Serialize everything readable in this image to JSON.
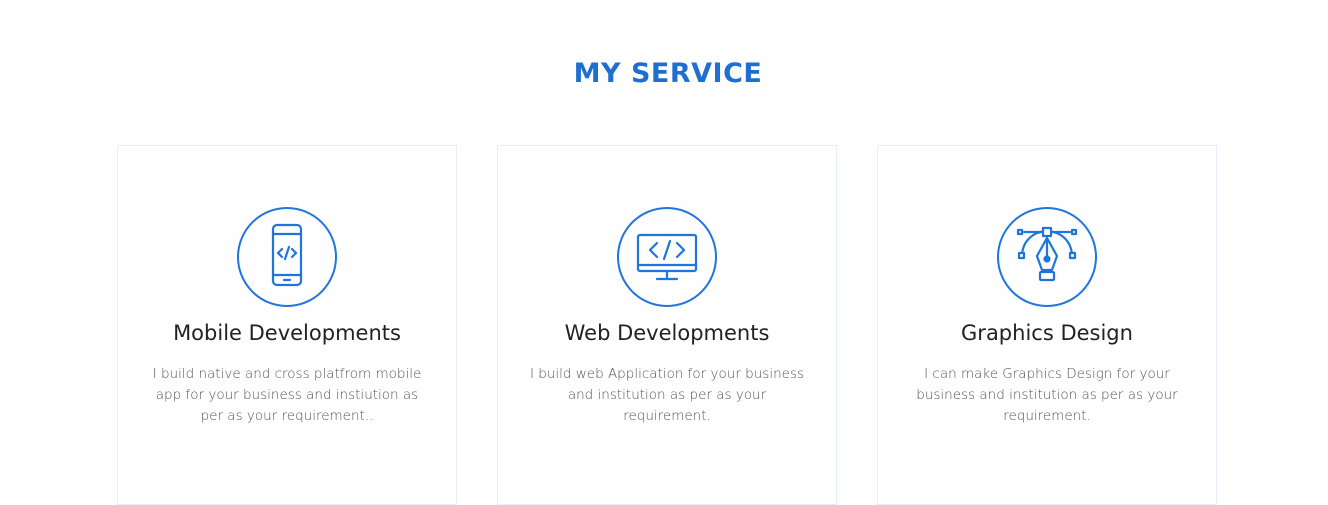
{
  "section": {
    "title": "MY SERVICE"
  },
  "services": [
    {
      "icon": "mobile-code-icon",
      "title": "Mobile Developments",
      "description": "I build native and cross platfrom mobile app for your business and instiution as per as your requirement.."
    },
    {
      "icon": "monitor-code-icon",
      "title": "Web Developments",
      "description": "I build web Application for your business and institution as per as your requirement."
    },
    {
      "icon": "pen-tool-icon",
      "title": "Graphics Design",
      "description": "I can make Graphics Design for your business and institution as per as your requirement."
    }
  ],
  "colors": {
    "accent": "#1f75dc",
    "title": "#1f6fd3",
    "text": "#555555",
    "heading": "#222222"
  }
}
